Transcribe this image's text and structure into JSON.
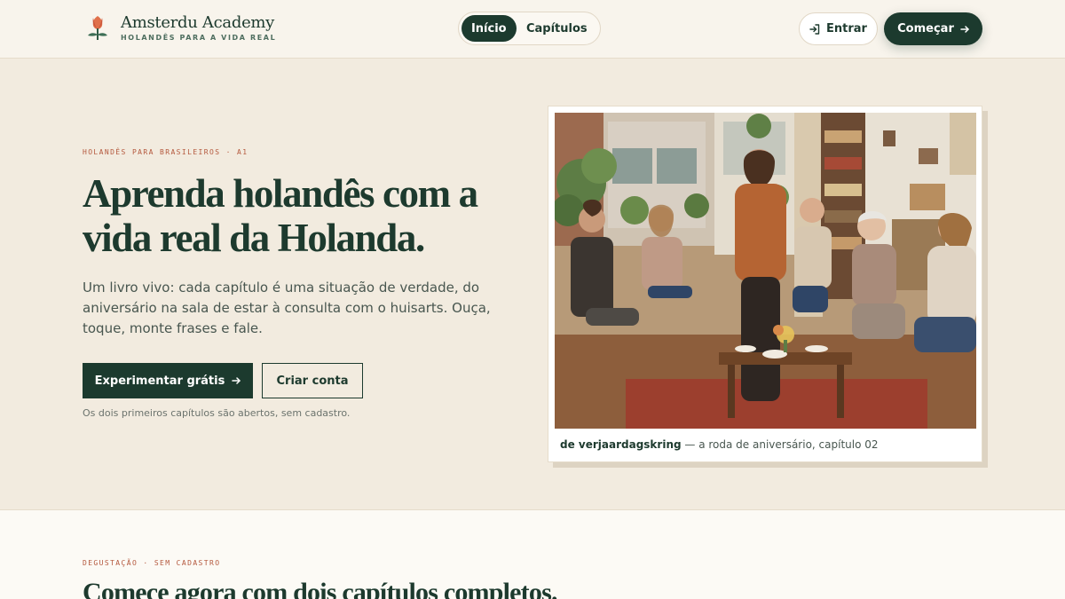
{
  "header": {
    "brand_name": "Amsterdu Academy",
    "brand_tagline": "HOLANDÊS PARA A VIDA REAL",
    "nav": [
      {
        "label": "Início",
        "active": true
      },
      {
        "label": "Capítulos",
        "active": false
      }
    ],
    "login_label": "Entrar",
    "start_label": "Começar"
  },
  "hero": {
    "eyebrow": "HOLANDÊS PARA BRASILEIROS · A1",
    "title": "Aprenda holandês com a vida real da Holanda.",
    "description": "Um livro vivo: cada capítulo é uma situação de verdade, do aniversário na sala de estar à consulta com o huisarts. Ouça, toque, monte frases e fale.",
    "primary_cta": "Experimentar grátis",
    "secondary_cta": "Criar conta",
    "note": "Os dois primeiros capítulos são abertos, sem cadastro."
  },
  "photo": {
    "caption_dutch": "de verjaardagskring",
    "caption_rest": " — a roda de aniversário, capítulo 02"
  },
  "tasting": {
    "eyebrow": "DEGUSTAÇÃO · SEM CADASTRO",
    "title": "Comece agora com dois capítulos completos."
  },
  "colors": {
    "brand_green": "#1c3a2e",
    "accent_terracotta": "#b4583d",
    "hero_bg": "#f2ebdf"
  },
  "icons": {
    "logo": "tulip-icon",
    "login": "login-arrow-icon",
    "arrow": "arrow-right-icon"
  }
}
